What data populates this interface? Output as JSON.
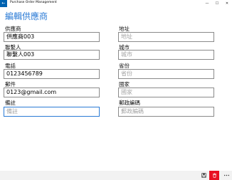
{
  "window": {
    "title": "Purchase Order Management",
    "back_glyph": "←",
    "controls": {
      "minimize": "—",
      "maximize": "☐",
      "close": "✕"
    }
  },
  "page": {
    "heading": "編輯供應商"
  },
  "form": {
    "left": [
      {
        "label": "供應商",
        "value": "供應商003",
        "placeholder": ""
      },
      {
        "label": "聯繫人",
        "value": "聯繫人003",
        "placeholder": ""
      },
      {
        "label": "電話",
        "value": "0123456789",
        "placeholder": ""
      },
      {
        "label": "郵件",
        "value": "0123@gmail.com",
        "placeholder": ""
      },
      {
        "label": "備註",
        "value": "",
        "placeholder": "備註"
      }
    ],
    "right": [
      {
        "label": "地址",
        "value": "",
        "placeholder": "地址"
      },
      {
        "label": "城市",
        "value": "",
        "placeholder": "城市"
      },
      {
        "label": "省份",
        "value": "",
        "placeholder": "省份"
      },
      {
        "label": "國家",
        "value": "",
        "placeholder": "國家"
      },
      {
        "label": "郵政編碼",
        "value": "",
        "placeholder": "郵政編碼"
      }
    ]
  },
  "commandbar": {
    "save_icon": "save-icon",
    "delete_icon": "trash-icon",
    "more_icon": "more-icon",
    "delete_color": "#e81123"
  },
  "colors": {
    "accent": "#2a7ad5",
    "titlebar_button": "#0063b1"
  }
}
